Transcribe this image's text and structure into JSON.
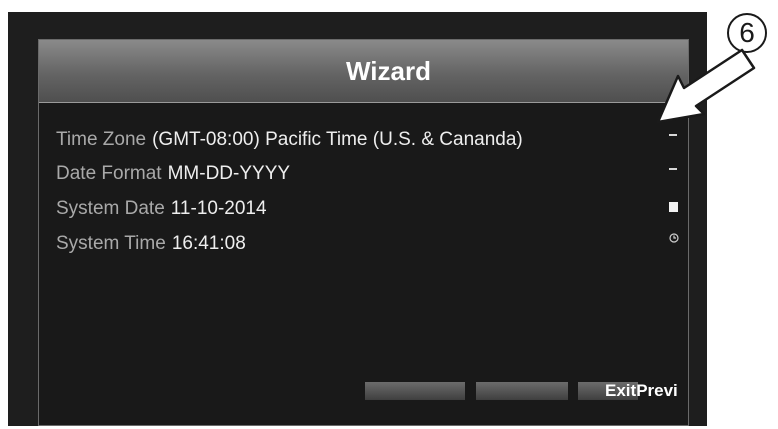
{
  "dialog": {
    "title": "Wizard",
    "fields": [
      {
        "label": "Time Zone",
        "value": "(GMT-08:00) Pacific Time (U.S. & Cananda)"
      },
      {
        "label": "Date Format",
        "value": "MM-DD-YYYY"
      },
      {
        "label": "System Date",
        "value": "11-10-2014"
      },
      {
        "label": "System Time",
        "value": "16:41:08"
      }
    ],
    "buttons": {
      "exit_label": "Exit",
      "previous_label": "Previ"
    }
  },
  "annotation": {
    "number": "6"
  },
  "icons": [
    "dropdown-icon",
    "dropdown-icon",
    "calendar-icon",
    "clock-icon",
    "arrow-icon"
  ]
}
